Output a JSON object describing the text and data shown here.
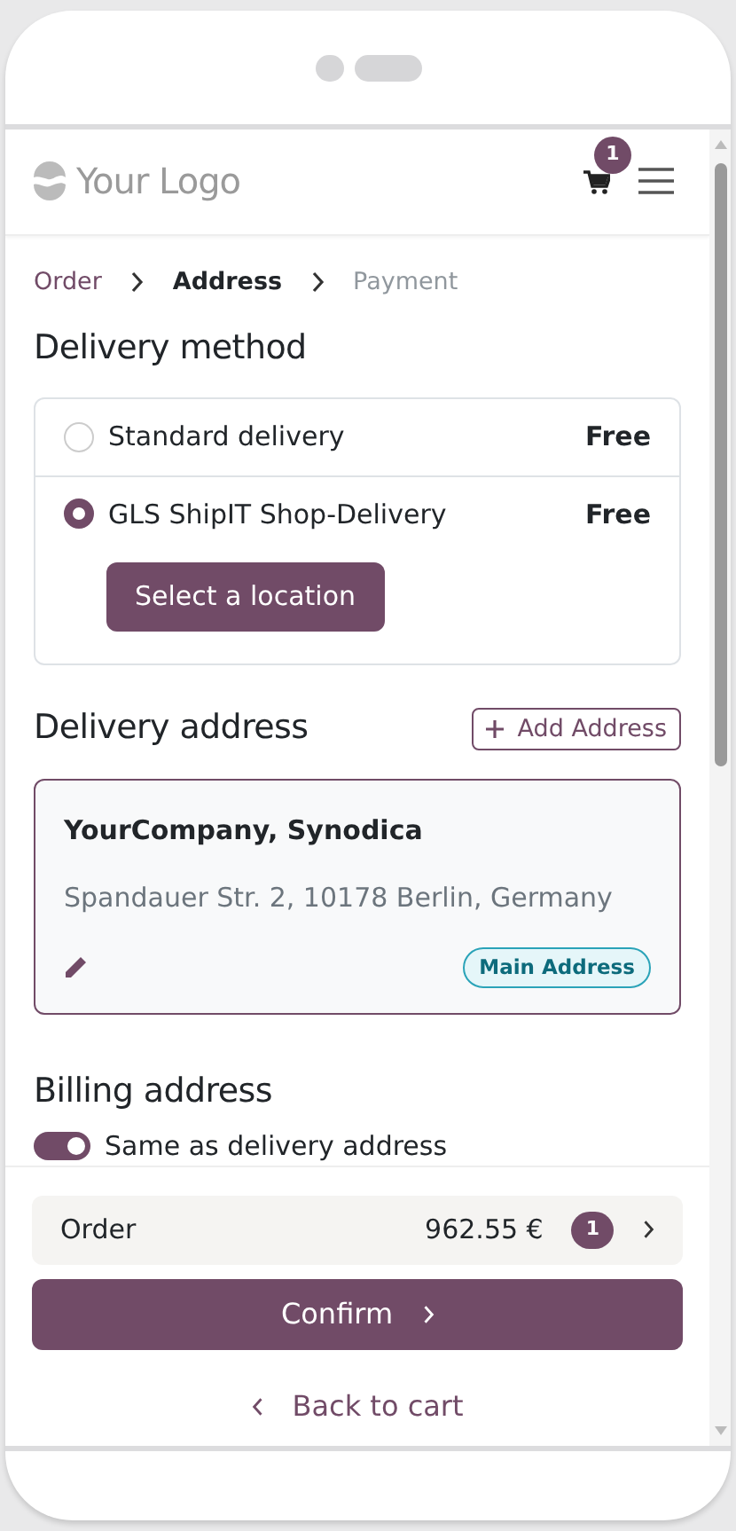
{
  "header": {
    "logo_text": "Your Logo",
    "cart_count": "1"
  },
  "breadcrumb": [
    {
      "label": "Order",
      "selected": false,
      "disabled": false
    },
    {
      "label": "Address",
      "selected": true,
      "disabled": false
    },
    {
      "label": "Payment",
      "selected": false,
      "disabled": true
    }
  ],
  "delivery_method": {
    "title": "Delivery method",
    "options": [
      {
        "label": "Standard delivery",
        "price": "Free",
        "selected": false
      },
      {
        "label": "GLS ShipIT Shop-Delivery",
        "price": "Free",
        "selected": true,
        "action": "Select a location"
      }
    ]
  },
  "delivery_address": {
    "title": "Delivery address",
    "add_button": "Add Address",
    "card": {
      "name": "YourCompany, Synodica",
      "address": "Spandauer Str. 2, 10178 Berlin, Germany",
      "badge": "Main Address",
      "selected": true
    }
  },
  "billing_address": {
    "title": "Billing address",
    "same_as_delivery": {
      "label": "Same as delivery address",
      "on": true
    }
  },
  "summary": {
    "label": "Order",
    "total": "962.55 €",
    "count": "1"
  },
  "confirm_button": "Confirm",
  "back_link": "Back to cart"
}
